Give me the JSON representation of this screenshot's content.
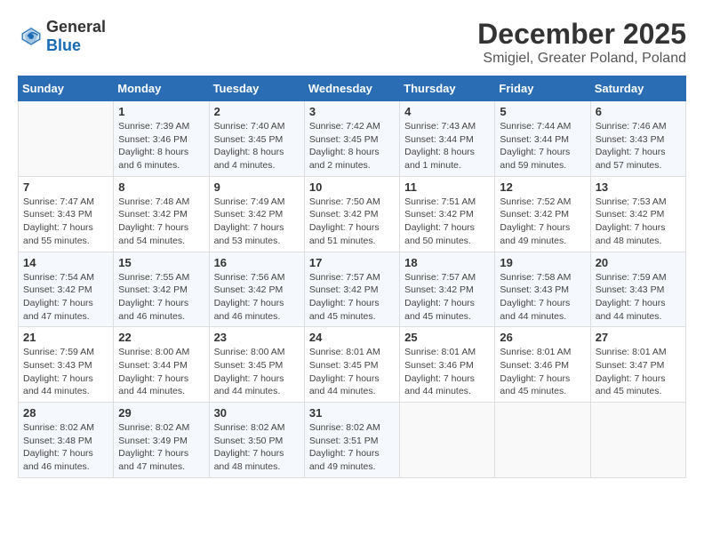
{
  "header": {
    "logo": {
      "general": "General",
      "blue": "Blue"
    },
    "title": "December 2025",
    "location": "Smigiel, Greater Poland, Poland"
  },
  "calendar": {
    "days_of_week": [
      "Sunday",
      "Monday",
      "Tuesday",
      "Wednesday",
      "Thursday",
      "Friday",
      "Saturday"
    ],
    "weeks": [
      [
        {
          "day": "",
          "info": ""
        },
        {
          "day": "1",
          "info": "Sunrise: 7:39 AM\nSunset: 3:46 PM\nDaylight: 8 hours\nand 6 minutes."
        },
        {
          "day": "2",
          "info": "Sunrise: 7:40 AM\nSunset: 3:45 PM\nDaylight: 8 hours\nand 4 minutes."
        },
        {
          "day": "3",
          "info": "Sunrise: 7:42 AM\nSunset: 3:45 PM\nDaylight: 8 hours\nand 2 minutes."
        },
        {
          "day": "4",
          "info": "Sunrise: 7:43 AM\nSunset: 3:44 PM\nDaylight: 8 hours\nand 1 minute."
        },
        {
          "day": "5",
          "info": "Sunrise: 7:44 AM\nSunset: 3:44 PM\nDaylight: 7 hours\nand 59 minutes."
        },
        {
          "day": "6",
          "info": "Sunrise: 7:46 AM\nSunset: 3:43 PM\nDaylight: 7 hours\nand 57 minutes."
        }
      ],
      [
        {
          "day": "7",
          "info": "Sunrise: 7:47 AM\nSunset: 3:43 PM\nDaylight: 7 hours\nand 55 minutes."
        },
        {
          "day": "8",
          "info": "Sunrise: 7:48 AM\nSunset: 3:42 PM\nDaylight: 7 hours\nand 54 minutes."
        },
        {
          "day": "9",
          "info": "Sunrise: 7:49 AM\nSunset: 3:42 PM\nDaylight: 7 hours\nand 53 minutes."
        },
        {
          "day": "10",
          "info": "Sunrise: 7:50 AM\nSunset: 3:42 PM\nDaylight: 7 hours\nand 51 minutes."
        },
        {
          "day": "11",
          "info": "Sunrise: 7:51 AM\nSunset: 3:42 PM\nDaylight: 7 hours\nand 50 minutes."
        },
        {
          "day": "12",
          "info": "Sunrise: 7:52 AM\nSunset: 3:42 PM\nDaylight: 7 hours\nand 49 minutes."
        },
        {
          "day": "13",
          "info": "Sunrise: 7:53 AM\nSunset: 3:42 PM\nDaylight: 7 hours\nand 48 minutes."
        }
      ],
      [
        {
          "day": "14",
          "info": "Sunrise: 7:54 AM\nSunset: 3:42 PM\nDaylight: 7 hours\nand 47 minutes."
        },
        {
          "day": "15",
          "info": "Sunrise: 7:55 AM\nSunset: 3:42 PM\nDaylight: 7 hours\nand 46 minutes."
        },
        {
          "day": "16",
          "info": "Sunrise: 7:56 AM\nSunset: 3:42 PM\nDaylight: 7 hours\nand 46 minutes."
        },
        {
          "day": "17",
          "info": "Sunrise: 7:57 AM\nSunset: 3:42 PM\nDaylight: 7 hours\nand 45 minutes."
        },
        {
          "day": "18",
          "info": "Sunrise: 7:57 AM\nSunset: 3:42 PM\nDaylight: 7 hours\nand 45 minutes."
        },
        {
          "day": "19",
          "info": "Sunrise: 7:58 AM\nSunset: 3:43 PM\nDaylight: 7 hours\nand 44 minutes."
        },
        {
          "day": "20",
          "info": "Sunrise: 7:59 AM\nSunset: 3:43 PM\nDaylight: 7 hours\nand 44 minutes."
        }
      ],
      [
        {
          "day": "21",
          "info": "Sunrise: 7:59 AM\nSunset: 3:43 PM\nDaylight: 7 hours\nand 44 minutes."
        },
        {
          "day": "22",
          "info": "Sunrise: 8:00 AM\nSunset: 3:44 PM\nDaylight: 7 hours\nand 44 minutes."
        },
        {
          "day": "23",
          "info": "Sunrise: 8:00 AM\nSunset: 3:45 PM\nDaylight: 7 hours\nand 44 minutes."
        },
        {
          "day": "24",
          "info": "Sunrise: 8:01 AM\nSunset: 3:45 PM\nDaylight: 7 hours\nand 44 minutes."
        },
        {
          "day": "25",
          "info": "Sunrise: 8:01 AM\nSunset: 3:46 PM\nDaylight: 7 hours\nand 44 minutes."
        },
        {
          "day": "26",
          "info": "Sunrise: 8:01 AM\nSunset: 3:46 PM\nDaylight: 7 hours\nand 45 minutes."
        },
        {
          "day": "27",
          "info": "Sunrise: 8:01 AM\nSunset: 3:47 PM\nDaylight: 7 hours\nand 45 minutes."
        }
      ],
      [
        {
          "day": "28",
          "info": "Sunrise: 8:02 AM\nSunset: 3:48 PM\nDaylight: 7 hours\nand 46 minutes."
        },
        {
          "day": "29",
          "info": "Sunrise: 8:02 AM\nSunset: 3:49 PM\nDaylight: 7 hours\nand 47 minutes."
        },
        {
          "day": "30",
          "info": "Sunrise: 8:02 AM\nSunset: 3:50 PM\nDaylight: 7 hours\nand 48 minutes."
        },
        {
          "day": "31",
          "info": "Sunrise: 8:02 AM\nSunset: 3:51 PM\nDaylight: 7 hours\nand 49 minutes."
        },
        {
          "day": "",
          "info": ""
        },
        {
          "day": "",
          "info": ""
        },
        {
          "day": "",
          "info": ""
        }
      ]
    ]
  }
}
